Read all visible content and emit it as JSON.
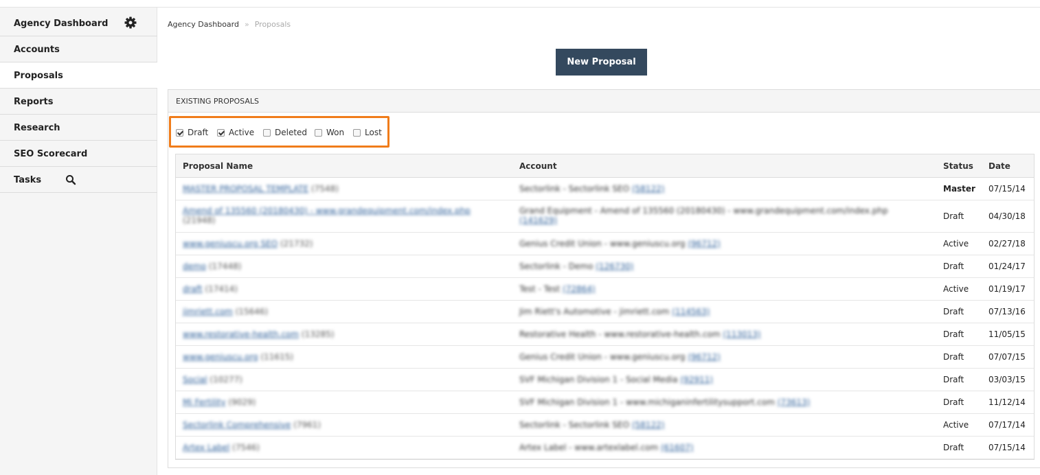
{
  "sidebar": {
    "items": [
      {
        "label": "Agency Dashboard"
      },
      {
        "label": "Accounts"
      },
      {
        "label": "Proposals"
      },
      {
        "label": "Reports"
      },
      {
        "label": "Research"
      },
      {
        "label": "SEO Scorecard"
      },
      {
        "label": "Tasks"
      }
    ],
    "icons": {
      "settings": "gear-icon",
      "search": "search-icon"
    }
  },
  "breadcrumb": {
    "root": "Agency Dashboard",
    "separator": "»",
    "current": "Proposals"
  },
  "actions": {
    "new_proposal": "New Proposal"
  },
  "panel": {
    "title": "EXISTING PROPOSALS"
  },
  "filters": [
    {
      "label": "Draft",
      "checked": true
    },
    {
      "label": "Active",
      "checked": true
    },
    {
      "label": "Deleted",
      "checked": false
    },
    {
      "label": "Won",
      "checked": false
    },
    {
      "label": "Lost",
      "checked": false
    }
  ],
  "table": {
    "headers": [
      "Proposal Name",
      "Account",
      "Status",
      "Date"
    ],
    "rows": [
      {
        "name": "MASTER PROPOSAL TEMPLATE",
        "id": "(7548)",
        "account": "Sectorlink - Sectorlink SEO",
        "account_id": "(58122)",
        "status": "Master",
        "date": "07/15/14"
      },
      {
        "name": "Amend of 135560 (20180430) - www.grandequipment.com/index.php",
        "id": "(21948)",
        "account": "Grand Equipment - Amend of 135560 (20180430) - www.grandequipment.com/index.php",
        "account_id": "(141629)",
        "status": "Draft",
        "date": "04/30/18"
      },
      {
        "name": "www.geniuscu.org SEO",
        "id": "(21732)",
        "account": "Genius Credit Union - www.geniuscu.org",
        "account_id": "(96712)",
        "status": "Active",
        "date": "02/27/18"
      },
      {
        "name": "demo",
        "id": "(17448)",
        "account": "Sectorlink - Demo",
        "account_id": "(126730)",
        "status": "Draft",
        "date": "01/24/17"
      },
      {
        "name": "draft",
        "id": "(17414)",
        "account": "Test - Test",
        "account_id": "(72864)",
        "status": "Active",
        "date": "01/19/17"
      },
      {
        "name": "jimriett.com",
        "id": "(15646)",
        "account": "Jim Riett's Automotive - jimriett.com",
        "account_id": "(114563)",
        "status": "Draft",
        "date": "07/13/16"
      },
      {
        "name": "www.restorative-health.com",
        "id": "(13285)",
        "account": "Restorative Health - www.restorative-health.com",
        "account_id": "(113013)",
        "status": "Draft",
        "date": "11/05/15"
      },
      {
        "name": "www.geniuscu.org",
        "id": "(11615)",
        "account": "Genius Credit Union - www.geniuscu.org",
        "account_id": "(96712)",
        "status": "Draft",
        "date": "07/07/15"
      },
      {
        "name": "Social",
        "id": "(10277)",
        "account": "SVF Michigan Division 1 - Social Media",
        "account_id": "(92911)",
        "status": "Draft",
        "date": "03/03/15"
      },
      {
        "name": "Mi Fertility",
        "id": "(9029)",
        "account": "SVF Michigan Division 1 - www.michiganinfertilitysupport.com",
        "account_id": "(73613)",
        "status": "Draft",
        "date": "11/12/14"
      },
      {
        "name": "Sectorlink Comprehensive",
        "id": "(7961)",
        "account": "Sectorlink - Sectorlink SEO",
        "account_id": "(58122)",
        "status": "Active",
        "date": "07/17/14"
      },
      {
        "name": "Artex Label",
        "id": "(7546)",
        "account": "Artex Label - www.artexlabel.com",
        "account_id": "(61607)",
        "status": "Draft",
        "date": "07/15/14"
      }
    ]
  }
}
